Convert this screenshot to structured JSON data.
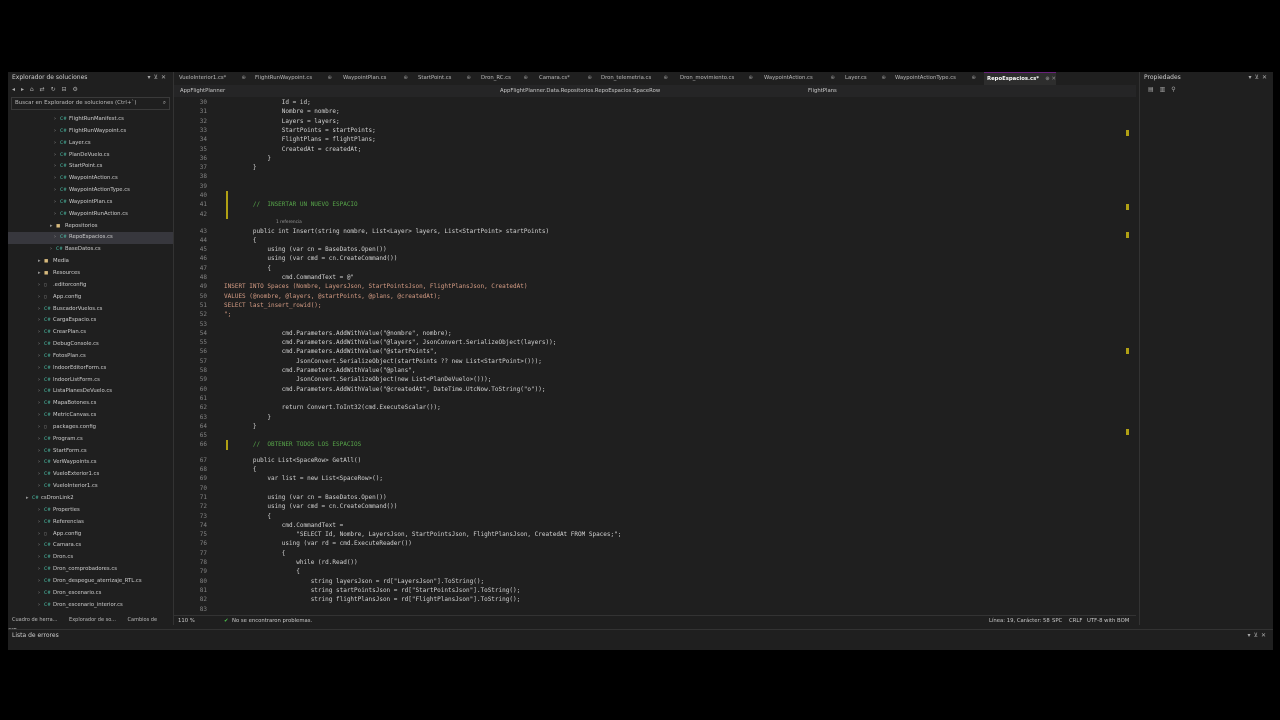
{
  "solution_explorer": {
    "title": "Explorador de soluciones",
    "search_placeholder": "Buscar en Explorador de soluciones (Ctrl+`)",
    "items": [
      {
        "label": "FlightRunManifest.cs",
        "icon": "C#",
        "depth": 3
      },
      {
        "label": "FlightRunWaypoint.cs",
        "icon": "C#",
        "depth": 3
      },
      {
        "label": "Layer.cs",
        "icon": "C#",
        "depth": 3
      },
      {
        "label": "PlanDeVuelo.cs",
        "icon": "C#",
        "depth": 3
      },
      {
        "label": "StartPoint.cs",
        "icon": "C#",
        "depth": 3
      },
      {
        "label": "WaypointAction.cs",
        "icon": "C#",
        "depth": 3
      },
      {
        "label": "WaypointActionType.cs",
        "icon": "C#",
        "depth": 3
      },
      {
        "label": "WaypointPlan.cs",
        "icon": "C#",
        "depth": 3
      },
      {
        "label": "WaypointRunAction.cs",
        "icon": "C#",
        "depth": 3
      },
      {
        "label": "Repositorios",
        "icon": "folder",
        "depth": 2
      },
      {
        "label": "RepoEspacios.cs",
        "icon": "C#",
        "depth": 3,
        "selected": true
      },
      {
        "label": "BaseDatos.cs",
        "icon": "C#",
        "depth": 2
      },
      {
        "label": "Media",
        "icon": "folder",
        "depth": 1
      },
      {
        "label": "Resources",
        "icon": "folder",
        "depth": 1
      },
      {
        "label": ".editorconfig",
        "icon": "file",
        "depth": 1
      },
      {
        "label": "App.config",
        "icon": "file",
        "depth": 1
      },
      {
        "label": "BuscadorVuelos.cs",
        "icon": "C#",
        "depth": 1
      },
      {
        "label": "CargaEspacio.cs",
        "icon": "C#",
        "depth": 1
      },
      {
        "label": "CrearPlan.cs",
        "icon": "C#",
        "depth": 1
      },
      {
        "label": "DebugConsole.cs",
        "icon": "C#",
        "depth": 1
      },
      {
        "label": "FotosPlan.cs",
        "icon": "C#",
        "depth": 1
      },
      {
        "label": "IndoorEditorForm.cs",
        "icon": "C#",
        "depth": 1
      },
      {
        "label": "IndoorListForm.cs",
        "icon": "C#",
        "depth": 1
      },
      {
        "label": "ListaPlanesDeVuelo.cs",
        "icon": "C#",
        "depth": 1
      },
      {
        "label": "MapaBotones.cs",
        "icon": "C#",
        "depth": 1
      },
      {
        "label": "MetricCanvas.cs",
        "icon": "C#",
        "depth": 1
      },
      {
        "label": "packages.config",
        "icon": "file",
        "depth": 1
      },
      {
        "label": "Program.cs",
        "icon": "C#",
        "depth": 1
      },
      {
        "label": "StartForm.cs",
        "icon": "C#",
        "depth": 1
      },
      {
        "label": "VerWaypoints.cs",
        "icon": "C#",
        "depth": 1
      },
      {
        "label": "VueloExterior1.cs",
        "icon": "C#",
        "depth": 1
      },
      {
        "label": "VueloInterior1.cs",
        "icon": "C#",
        "depth": 1
      },
      {
        "label": "csDronLink2",
        "icon": "C#",
        "depth": 0
      },
      {
        "label": "Properties",
        "icon": "C#",
        "depth": 1
      },
      {
        "label": "Referencias",
        "icon": "C#",
        "depth": 1
      },
      {
        "label": "App.config",
        "icon": "file",
        "depth": 1
      },
      {
        "label": "Camara.cs",
        "icon": "C#",
        "depth": 1
      },
      {
        "label": "Dron.cs",
        "icon": "C#",
        "depth": 1
      },
      {
        "label": "Dron_comprobadores.cs",
        "icon": "C#",
        "depth": 1
      },
      {
        "label": "Dron_despegue_aterrizaje_RTL.cs",
        "icon": "C#",
        "depth": 1
      },
      {
        "label": "Dron_escenario.cs",
        "icon": "C#",
        "depth": 1
      },
      {
        "label": "Dron_escenario_interior.cs",
        "icon": "C#",
        "depth": 1
      }
    ],
    "bottom_tabs": [
      "Cuadro de herra...",
      "Explorador de so...",
      "Cambios de GIT..."
    ]
  },
  "tabs": [
    {
      "label": "VueloInterior1.cs*"
    },
    {
      "label": "FlightRunWaypoint.cs"
    },
    {
      "label": "WaypointPlan.cs"
    },
    {
      "label": "StartPoint.cs"
    },
    {
      "label": "Dron_RC.cs"
    },
    {
      "label": "Camara.cs*"
    },
    {
      "label": "Dron_telemetria.cs"
    },
    {
      "label": "Dron_movimiento.cs"
    },
    {
      "label": "WaypointAction.cs"
    },
    {
      "label": "Layer.cs"
    },
    {
      "label": "WaypointActionType.cs"
    },
    {
      "label": "RepoEspacios.cs*",
      "active": true
    }
  ],
  "navbar": {
    "project": "AppFlightPlanner",
    "type": "AppFlightPlanner.Data.Repositorios.RepoEspacios.SpaceRow",
    "member": "FlightPlans"
  },
  "code_lines": [
    {
      "n": "30",
      "t": "                Id = id;"
    },
    {
      "n": "31",
      "t": "                Nombre = nombre;"
    },
    {
      "n": "32",
      "t": "                Layers = layers;"
    },
    {
      "n": "33",
      "t": "                StartPoints = startPoints;"
    },
    {
      "n": "34",
      "t": "                FlightPlans = flightPlans;"
    },
    {
      "n": "35",
      "t": "                CreatedAt = createdAt;"
    },
    {
      "n": "36",
      "t": "            }"
    },
    {
      "n": "37",
      "t": "        }"
    },
    {
      "n": "38",
      "t": ""
    },
    {
      "n": "39",
      "t": ""
    },
    {
      "n": "40",
      "t": ""
    },
    {
      "n": "41",
      "t": "        //  INSERTAR UN NUEVO ESPACIO",
      "cls": "cmt"
    },
    {
      "n": "42",
      "t": ""
    },
    {
      "n": "43",
      "t": "        public int Insert(string nombre, List<Layer> layers, List<StartPoint> startPoints)"
    },
    {
      "n": "44",
      "t": "        {"
    },
    {
      "n": "45",
      "t": "            using (var cn = BaseDatos.Open())"
    },
    {
      "n": "46",
      "t": "            using (var cmd = cn.CreateCommand())"
    },
    {
      "n": "47",
      "t": "            {"
    },
    {
      "n": "48",
      "t": "                cmd.CommandText = @\""
    },
    {
      "n": "49",
      "t": "INSERT INTO Spaces (Nombre, LayersJson, StartPointsJson, FlightPlansJson, CreatedAt)",
      "cls": "str"
    },
    {
      "n": "50",
      "t": "VALUES (@nombre, @layers, @startPoints, @plans, @createdAt);",
      "cls": "str"
    },
    {
      "n": "51",
      "t": "SELECT last_insert_rowid();",
      "cls": "str"
    },
    {
      "n": "52",
      "t": "\";",
      "cls": "str"
    },
    {
      "n": "53",
      "t": ""
    },
    {
      "n": "54",
      "t": "                cmd.Parameters.AddWithValue(\"@nombre\", nombre);"
    },
    {
      "n": "55",
      "t": "                cmd.Parameters.AddWithValue(\"@layers\", JsonConvert.SerializeObject(layers));"
    },
    {
      "n": "56",
      "t": "                cmd.Parameters.AddWithValue(\"@startPoints\","
    },
    {
      "n": "57",
      "t": "                    JsonConvert.SerializeObject(startPoints ?? new List<StartPoint>()));"
    },
    {
      "n": "58",
      "t": "                cmd.Parameters.AddWithValue(\"@plans\","
    },
    {
      "n": "59",
      "t": "                    JsonConvert.SerializeObject(new List<PlanDeVuelo>()));"
    },
    {
      "n": "60",
      "t": "                cmd.Parameters.AddWithValue(\"@createdAt\", DateTime.UtcNow.ToString(\"o\"));"
    },
    {
      "n": "61",
      "t": ""
    },
    {
      "n": "62",
      "t": "                return Convert.ToInt32(cmd.ExecuteScalar());"
    },
    {
      "n": "63",
      "t": "            }"
    },
    {
      "n": "64",
      "t": "        }"
    },
    {
      "n": "65",
      "t": ""
    },
    {
      "n": "66",
      "t": "        //  OBTENER TODOS LOS ESPACIOS",
      "cls": "cmt"
    },
    {
      "n": "67",
      "t": "        public List<SpaceRow> GetAll()"
    },
    {
      "n": "68",
      "t": "        {"
    },
    {
      "n": "69",
      "t": "            var list = new List<SpaceRow>();"
    },
    {
      "n": "70",
      "t": ""
    },
    {
      "n": "71",
      "t": "            using (var cn = BaseDatos.Open())"
    },
    {
      "n": "72",
      "t": "            using (var cmd = cn.CreateCommand())"
    },
    {
      "n": "73",
      "t": "            {"
    },
    {
      "n": "74",
      "t": "                cmd.CommandText ="
    },
    {
      "n": "75",
      "t": "                    \"SELECT Id, Nombre, LayersJson, StartPointsJson, FlightPlansJson, CreatedAt FROM Spaces;\";"
    },
    {
      "n": "76",
      "t": "                using (var rd = cmd.ExecuteReader())"
    },
    {
      "n": "77",
      "t": "                {"
    },
    {
      "n": "78",
      "t": "                    while (rd.Read())"
    },
    {
      "n": "79",
      "t": "                    {"
    },
    {
      "n": "80",
      "t": "                        string layersJson = rd[\"LayersJson\"].ToString();"
    },
    {
      "n": "81",
      "t": "                        string startPointsJson = rd[\"StartPointsJson\"].ToString();"
    },
    {
      "n": "82",
      "t": "                        string flightPlansJson = rd[\"FlightPlansJson\"].ToString();"
    },
    {
      "n": "83",
      "t": ""
    }
  ],
  "codelens": {
    "text": "1 referencia"
  },
  "status": {
    "zoom": "110 %",
    "problems": "No se encontraron problemas.",
    "position": "Línea: 19, Carácter: 58",
    "insert": "SPC",
    "eol": "CRLF",
    "encoding": "UTF-8 with BOM"
  },
  "properties": {
    "title": "Propiedades"
  },
  "error_list": {
    "title": "Lista de errores"
  }
}
